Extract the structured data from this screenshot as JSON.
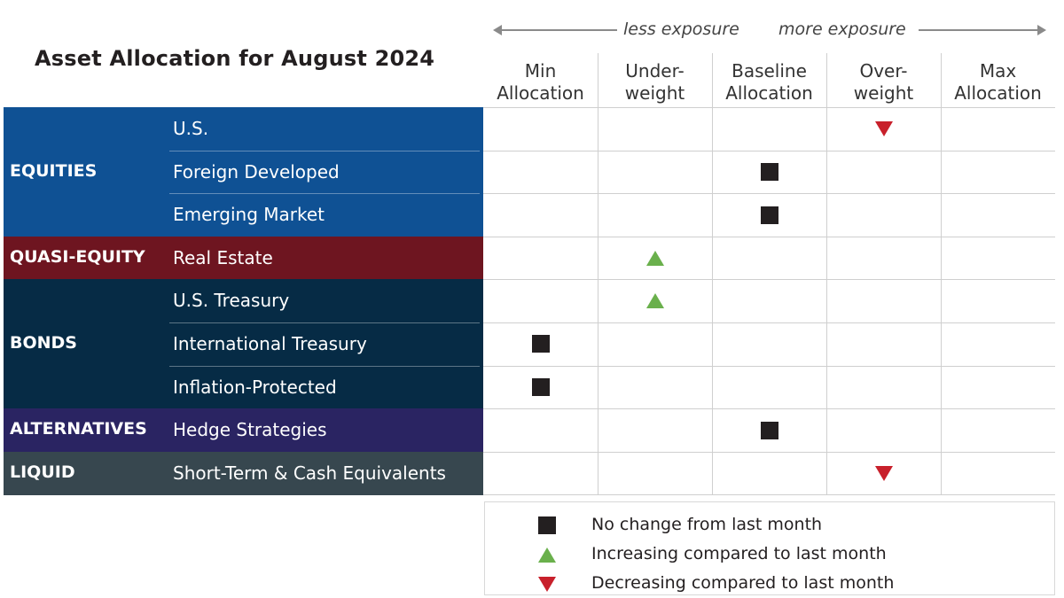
{
  "chart_data": {
    "type": "table",
    "title": "Asset Allocation for August 2024",
    "exposure_axis": {
      "left_label": "less exposure",
      "right_label": "more exposure"
    },
    "columns": [
      "Min Allocation",
      "Under-weight",
      "Baseline Allocation",
      "Over-weight",
      "Max Allocation"
    ],
    "column_lines": [
      [
        "Min",
        "Allocation"
      ],
      [
        "Under-",
        "weight"
      ],
      [
        "Baseline",
        "Allocation"
      ],
      [
        "Over-",
        "weight"
      ],
      [
        "Max",
        "Allocation"
      ]
    ],
    "groups": [
      {
        "name": "EQUITIES",
        "color": "#0f5194",
        "rows": [
          {
            "label": "U.S.",
            "column": "Over-weight",
            "column_index": 3,
            "change": "decreasing"
          },
          {
            "label": "Foreign Developed",
            "column": "Baseline Allocation",
            "column_index": 2,
            "change": "no-change"
          },
          {
            "label": "Emerging Market",
            "column": "Baseline Allocation",
            "column_index": 2,
            "change": "no-change"
          }
        ]
      },
      {
        "name": "QUASI-EQUITY",
        "color": "#6e1520",
        "rows": [
          {
            "label": "Real Estate",
            "column": "Under-weight",
            "column_index": 1,
            "change": "increasing"
          }
        ]
      },
      {
        "name": "BONDS",
        "color": "#062b45",
        "rows": [
          {
            "label": "U.S. Treasury",
            "column": "Under-weight",
            "column_index": 1,
            "change": "increasing"
          },
          {
            "label": "International Treasury",
            "column": "Min Allocation",
            "column_index": 0,
            "change": "no-change"
          },
          {
            "label": "Inflation-Protected",
            "column": "Min Allocation",
            "column_index": 0,
            "change": "no-change"
          }
        ]
      },
      {
        "name": "ALTERNATIVES",
        "color": "#2a2462",
        "rows": [
          {
            "label": "Hedge Strategies",
            "column": "Baseline Allocation",
            "column_index": 2,
            "change": "no-change"
          }
        ]
      },
      {
        "name": "LIQUID",
        "color": "#37474f",
        "rows": [
          {
            "label": "Short-Term & Cash Equivalents",
            "column": "Over-weight",
            "column_index": 3,
            "change": "decreasing"
          }
        ]
      }
    ],
    "legend": [
      {
        "symbol": "square-icon",
        "change": "no-change",
        "label": "No change from last month",
        "color": "#231f20"
      },
      {
        "symbol": "triangle-up-icon",
        "change": "increasing",
        "label": "Increasing compared to last month",
        "color": "#6ab04c"
      },
      {
        "symbol": "triangle-down-icon",
        "change": "decreasing",
        "label": "Decreasing compared to last month",
        "color": "#c8202b"
      }
    ]
  }
}
